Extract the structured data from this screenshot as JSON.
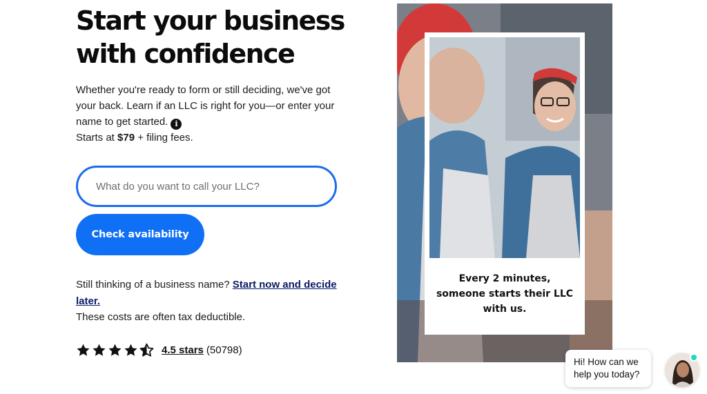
{
  "hero": {
    "headline_line1": "Start your business",
    "headline_line2": "with confidence",
    "intro_text": "Whether you're ready to form or still deciding, we've got your back. Learn if an LLC is right for you—or enter your name to get started.",
    "info_icon": "info-icon",
    "price_prefix": "Starts at ",
    "price_value": "$79",
    "price_suffix": " + filing fees."
  },
  "form": {
    "llc_name_placeholder": "What do you want to call your LLC?",
    "llc_name_value": "",
    "check_button_label": "Check availability"
  },
  "helper": {
    "thinking_text": "Still thinking of a business name? ",
    "start_now_link": "Start now and decide later.",
    "tax_note": "These costs are often tax deductible."
  },
  "rating": {
    "stars_value": 4.5,
    "stars_max": 5,
    "stars_link": "4.5 stars",
    "review_count": "(50798)"
  },
  "promo": {
    "caption_line1": "Every 2 minutes,",
    "caption_line2": "someone starts their LLC",
    "caption_line3": "with us."
  },
  "chat": {
    "line1": "Hi! How can we",
    "line2": "help you today?"
  },
  "colors": {
    "accent": "#0f6ff5",
    "input_border": "#1a6bf0",
    "link": "#0a1a66",
    "online": "#1ed9bd"
  }
}
